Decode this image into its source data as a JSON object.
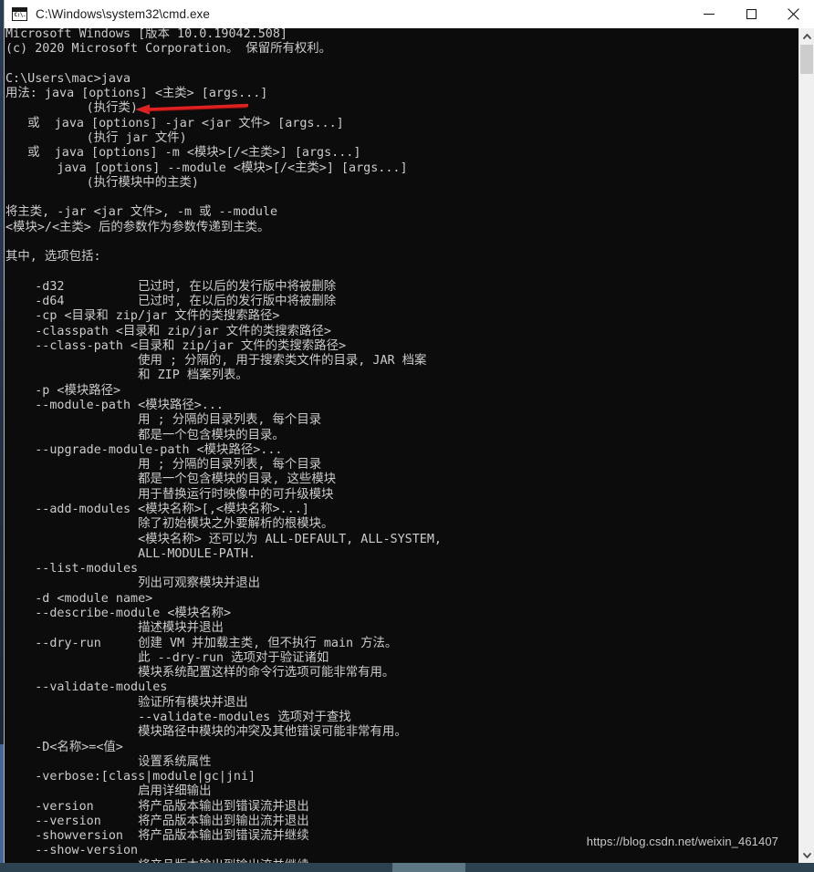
{
  "window": {
    "title": "C:\\Windows\\system32\\cmd.exe",
    "icon": "cmd-console-icon",
    "icon_prompt": "C:\\.",
    "controls": {
      "minimize_label": "Minimize",
      "maximize_label": "Maximize",
      "close_label": "Close"
    }
  },
  "scrollbar": {
    "up_arrow": "chevron-up-icon",
    "down_arrow": "chevron-down-icon",
    "thumb": "scrollbar-thumb"
  },
  "annotation": {
    "arrow": "red-left-arrow",
    "color": "#e02121",
    "points_at": "java"
  },
  "watermark": {
    "text": "https://blog.csdn.net/weixin_461407"
  },
  "console": {
    "foreground": "#cccccc",
    "background": "#0c0c0c",
    "prompt": "C:\\Users\\mac>",
    "command": "java",
    "text": "Microsoft Windows [版本 10.0.19042.508]\n(c) 2020 Microsoft Corporation。 保留所有权利。\n\nC:\\Users\\mac>java\n用法: java [options] <主类> [args...]\n           (执行类)\n   或  java [options] -jar <jar 文件> [args...]\n           (执行 jar 文件)\n   或  java [options] -m <模块>[/<主类>] [args...]\n       java [options] --module <模块>[/<主类>] [args...]\n           (执行模块中的主类)\n\n将主类, -jar <jar 文件>, -m 或 --module\n<模块>/<主类> 后的参数作为参数传递到主类。\n\n其中, 选项包括:\n\n    -d32          已过时, 在以后的发行版中将被删除\n    -d64          已过时, 在以后的发行版中将被删除\n    -cp <目录和 zip/jar 文件的类搜索路径>\n    -classpath <目录和 zip/jar 文件的类搜索路径>\n    --class-path <目录和 zip/jar 文件的类搜索路径>\n                  使用 ; 分隔的, 用于搜索类文件的目录, JAR 档案\n                  和 ZIP 档案列表。\n    -p <模块路径>\n    --module-path <模块路径>...\n                  用 ; 分隔的目录列表, 每个目录\n                  都是一个包含模块的目录。\n    --upgrade-module-path <模块路径>...\n                  用 ; 分隔的目录列表, 每个目录\n                  都是一个包含模块的目录, 这些模块\n                  用于替换运行时映像中的可升级模块\n    --add-modules <模块名称>[,<模块名称>...]\n                  除了初始模块之外要解析的根模块。\n                  <模块名称> 还可以为 ALL-DEFAULT, ALL-SYSTEM,\n                  ALL-MODULE-PATH.\n    --list-modules\n                  列出可观察模块并退出\n    -d <module name>\n    --describe-module <模块名称>\n                  描述模块并退出\n    --dry-run     创建 VM 并加载主类, 但不执行 main 方法。\n                  此 --dry-run 选项对于验证诸如\n                  模块系统配置这样的命令行选项可能非常有用。\n    --validate-modules\n                  验证所有模块并退出\n                  --validate-modules 选项对于查找\n                  模块路径中模块的冲突及其他错误可能非常有用。\n    -D<名称>=<值>\n                  设置系统属性\n    -verbose:[class|module|gc|jni]\n                  启用详细输出\n    -version      将产品版本输出到错误流并退出\n    --version     将产品版本输出到输出流并退出\n    -showversion  将产品版本输出到错误流并继续\n    --show-version\n                  将产品版本输出到输出流并继续"
  }
}
